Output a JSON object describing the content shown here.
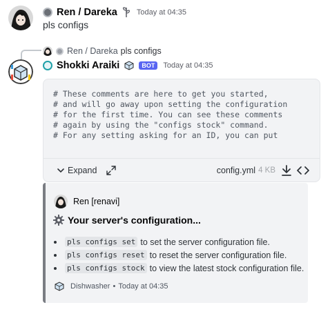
{
  "message1": {
    "author": "Ren / Dareka",
    "timestamp": "Today at 04:35",
    "content": "pls configs"
  },
  "reply": {
    "author": "Ren / Dareka",
    "content": "pls configs"
  },
  "message2": {
    "author": "Shokki Araiki",
    "badge": "BOT",
    "timestamp": "Today at 04:35",
    "attachment": {
      "code_lines": [
        "# These comments are here to get you started,",
        "# and will go away upon setting the configuration",
        "# for the first time. You can see these comments",
        "# again by using the \"configs stock\" command.",
        "",
        "# For any setting asking for an ID, you can put"
      ],
      "expand_label": "Expand",
      "file_name": "config.yml",
      "file_size": "4 KB"
    },
    "embed": {
      "author": "Ren [renavi]",
      "title": "Your server's configuration...",
      "items": [
        {
          "code": "pls configs set",
          "text": "to set the server configuration file."
        },
        {
          "code": "pls configs reset",
          "text": "to reset the server configuration file."
        },
        {
          "code": "pls configs stock",
          "text": "to view the latest stock configuration file."
        }
      ],
      "footer_name": "Dishwasher",
      "footer_sep": "•",
      "footer_time": "Today at 04:35"
    }
  },
  "colors": {
    "accent": "#5865f2",
    "embed_border": "#7a7d83",
    "role_teal": "#1fa0a8"
  }
}
